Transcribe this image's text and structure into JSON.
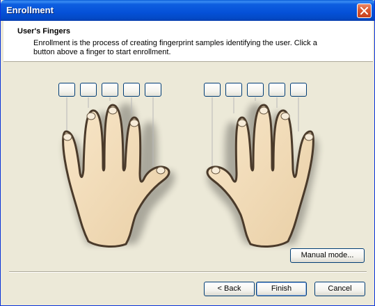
{
  "window": {
    "title": "Enrollment"
  },
  "header": {
    "title": "User's Fingers",
    "description": "Enrollment is the process of creating fingerprint samples identifying the user. Click a button above a finger to start enrollment."
  },
  "fingers": {
    "left_hand": [
      "left-little",
      "left-ring",
      "left-middle",
      "left-index",
      "left-thumb"
    ],
    "right_hand": [
      "right-thumb",
      "right-index",
      "right-middle",
      "right-ring",
      "right-little"
    ]
  },
  "buttons": {
    "manual_mode": "Manual mode...",
    "back": "< Back",
    "finish": "Finish",
    "cancel": "Cancel"
  },
  "colors": {
    "title_bar": "#0551d8",
    "skin": "#f3dcb8",
    "outline": "#4a3a2a",
    "panel": "#ece9d8"
  },
  "icons": {
    "close": "close-icon"
  }
}
